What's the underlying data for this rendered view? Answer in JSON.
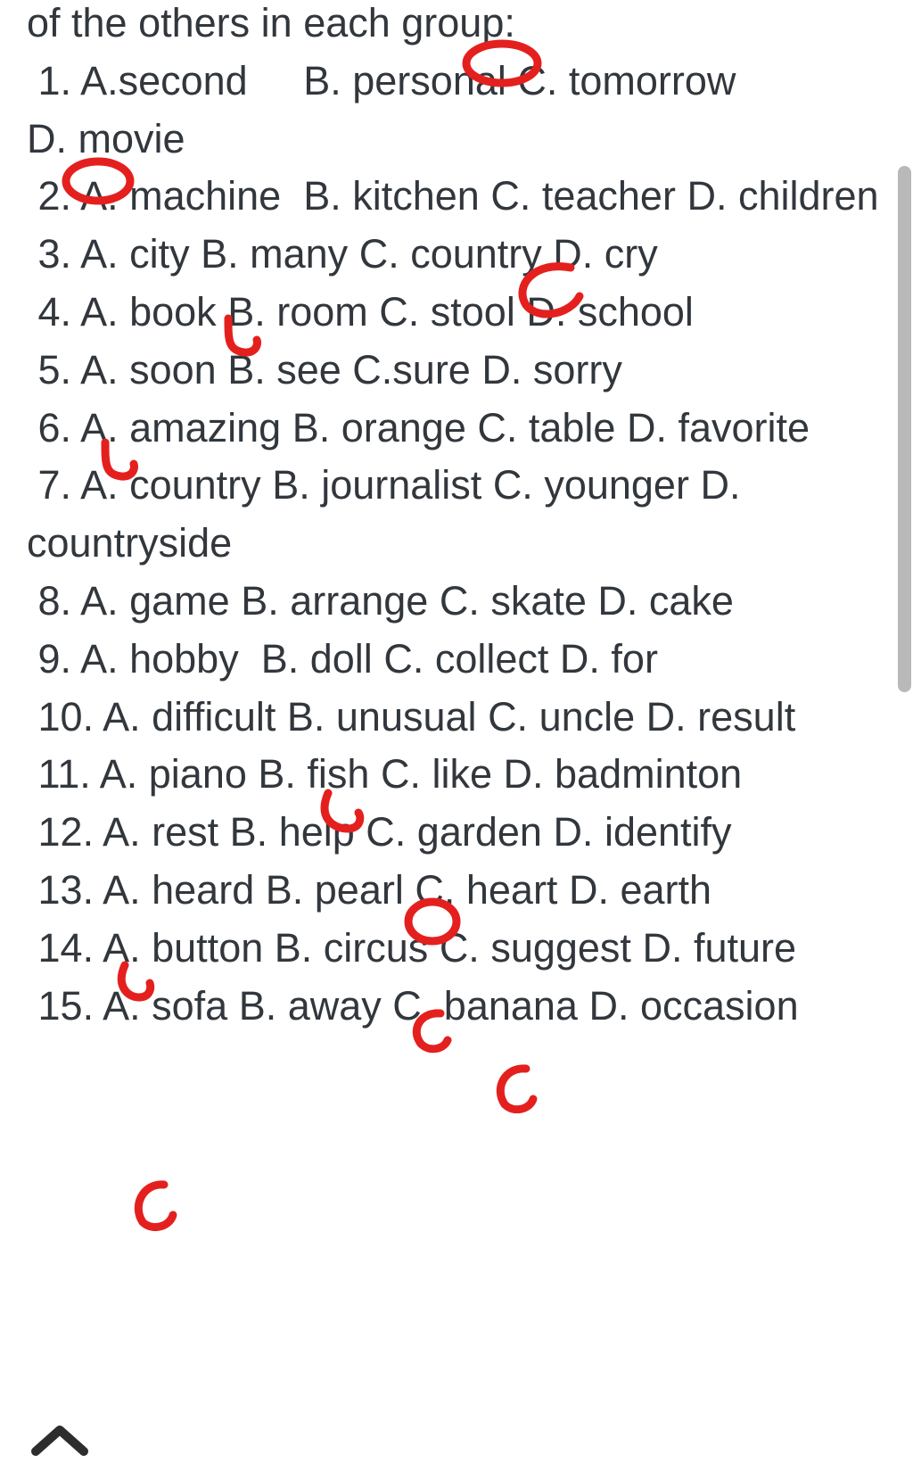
{
  "title_line": "of the others in each group:",
  "questions": {
    "q1": {
      "num": "1.",
      "a": "A.second",
      "b": "B. personal",
      "c": "C. tomorrow",
      "d": "D. movie"
    },
    "q2": {
      "num": "2.",
      "a": "A. machine",
      "b": "B. kitchen",
      "c": "C. teacher",
      "d": "D. children"
    },
    "q3": {
      "num": "3.",
      "a": "A. city",
      "b": "B. many",
      "c": "C. country",
      "d": "D. cry"
    },
    "q4": {
      "num": "4.",
      "a": "A. book",
      "b": "B. room",
      "c": "C. stool",
      "d": "D. school"
    },
    "q5": {
      "num": "5.",
      "a": "A. soon",
      "b": "B. see",
      "c": "C.sure",
      "d": "D. sorry"
    },
    "q6": {
      "num": "6.",
      "a": "A. amazing",
      "b": "B. orange",
      "c": "C. table",
      "d": "D. favorite"
    },
    "q7": {
      "num": "7.",
      "a": "A. country",
      "b": "B. journalist",
      "c": "C. younger",
      "d": "D. countryside"
    },
    "q8": {
      "num": "8.",
      "a": "A. game",
      "b": "B. arrange",
      "c": "C. skate",
      "d": "D. cake"
    },
    "q9": {
      "num": "9.",
      "a": "A. hobby",
      "b": "B. doll",
      "c": "C. collect",
      "d": "D. for"
    },
    "q10": {
      "num": "10.",
      "a": "A. difficult",
      "b": "B. unusual",
      "c": "C. uncle",
      "d": "D. result"
    },
    "q11": {
      "num": "11.",
      "a": "A. piano",
      "b": "B. fish",
      "c": "C. like",
      "d": "D. badminton"
    },
    "q12": {
      "num": "12.",
      "a": "A. rest",
      "b": "B. help",
      "c": "C. garden",
      "d": "D. identify"
    },
    "q13": {
      "num": "13.",
      "a": "A. heard",
      "b": "B. pearl",
      "c": "C. heart",
      "d": "D. earth"
    },
    "q14": {
      "num": "14.",
      "a": "A. button",
      "b": "B. circus",
      "c": "C. suggest",
      "d": "D. future"
    },
    "q15": {
      "num": "15.",
      "a": "A. sofa",
      "b": "B. away",
      "c": "C. banana",
      "d": "D. occasion"
    }
  },
  "spacer6": "    ",
  "mark_color": "#e4201e"
}
